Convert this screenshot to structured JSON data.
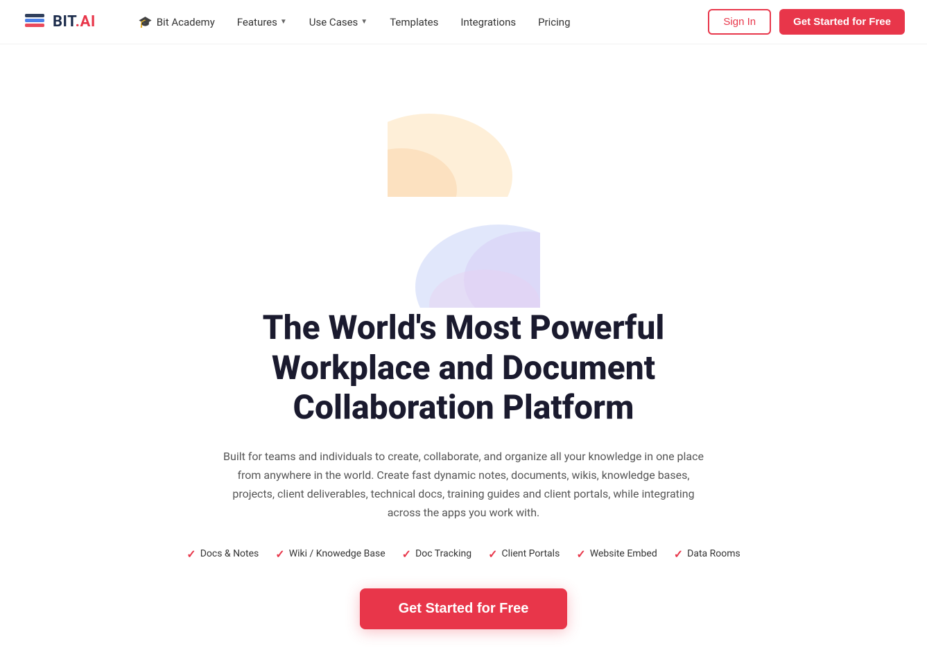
{
  "logo": {
    "brand": "BIT",
    "suffix": ".AI"
  },
  "nav": {
    "academy_label": "Bit Academy",
    "features_label": "Features",
    "use_cases_label": "Use Cases",
    "templates_label": "Templates",
    "integrations_label": "Integrations",
    "pricing_label": "Pricing",
    "signin_label": "Sign In",
    "signup_label": "Get Started for Free"
  },
  "hero": {
    "title_line1": "The World's Most Powerful",
    "title_line2": "Workplace and Document Collaboration Platform",
    "subtitle": "Built for teams and individuals to create, collaborate, and organize all your knowledge in one place from anywhere in the world. Create fast dynamic notes, documents, wikis, knowledge bases, projects, client deliverables, technical docs, training guides and client portals, while integrating across the apps you work with.",
    "cta_label": "Get Started for Free"
  },
  "features": [
    {
      "label": "Docs & Notes"
    },
    {
      "label": "Wiki / Knowedge Base"
    },
    {
      "label": "Doc Tracking"
    },
    {
      "label": "Client Portals"
    },
    {
      "label": "Website Embed"
    },
    {
      "label": "Data Rooms"
    }
  ],
  "colors": {
    "accent": "#e8364a",
    "text_primary": "#1a1a2e",
    "text_secondary": "#555555"
  }
}
